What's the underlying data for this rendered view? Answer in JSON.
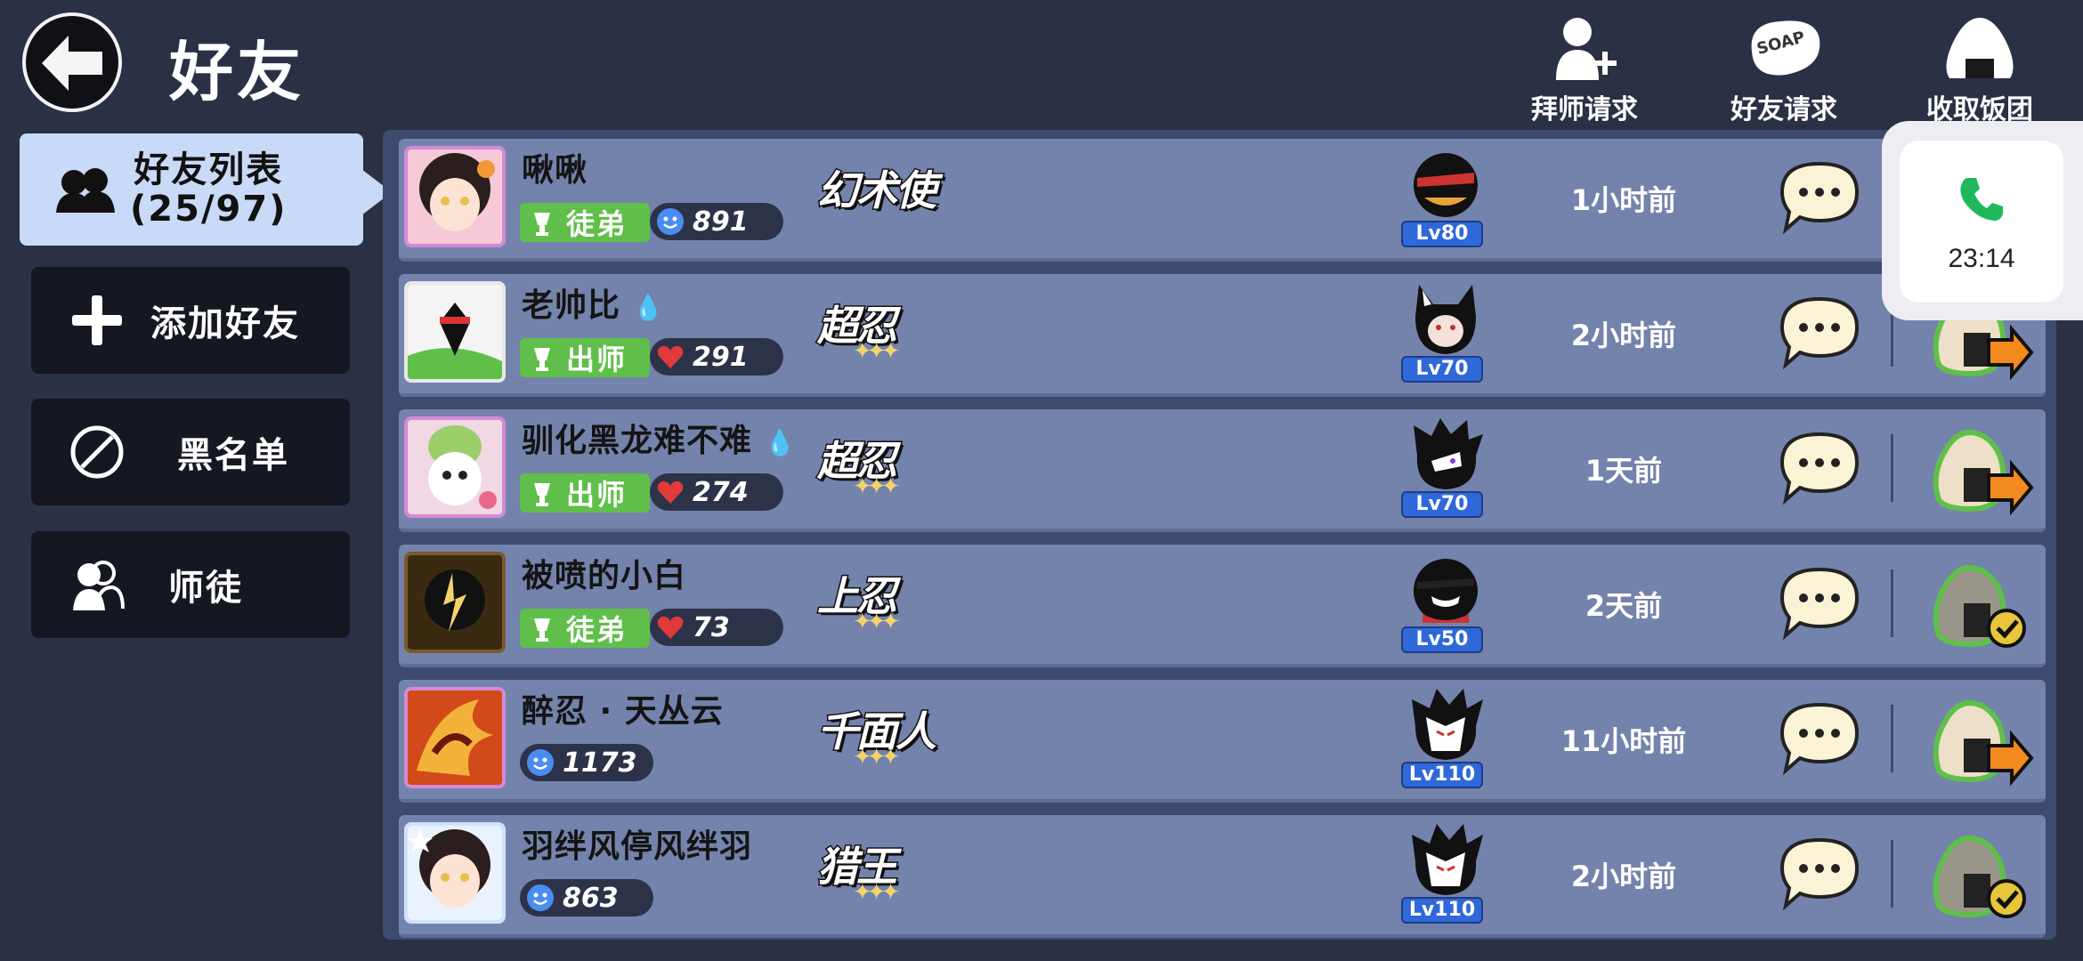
{
  "header": {
    "title": "好友",
    "actions": [
      {
        "label": "拜师请求",
        "icon": "add-mentor-icon"
      },
      {
        "label": "好友请求",
        "icon": "friend-request-icon",
        "icon_text": "SOAP"
      },
      {
        "label": "收取饭团",
        "icon": "rice-ball-icon"
      }
    ]
  },
  "sidebar": {
    "active": {
      "label": "好友列表",
      "count": "(25/97)"
    },
    "items": [
      {
        "label": "添加好友",
        "icon": "plus-icon"
      },
      {
        "label": "黑名单",
        "icon": "block-icon"
      },
      {
        "label": "师徒",
        "icon": "mentor-icon"
      }
    ]
  },
  "friends": [
    {
      "name": "啾啾",
      "relation": "徒弟",
      "stat_type": "intimacy",
      "stat": "891",
      "rank": "幻术使",
      "level": "Lv80",
      "last_seen": "1小时前",
      "gift": "send",
      "has_badge": false
    },
    {
      "name": "老帅比",
      "relation": "出师",
      "stat_type": "heart",
      "stat": "291",
      "rank": "超忍",
      "level": "Lv70",
      "last_seen": "2小时前",
      "gift": "send",
      "has_badge": true
    },
    {
      "name": "驯化黑龙难不难",
      "relation": "出师",
      "stat_type": "heart",
      "stat": "274",
      "rank": "超忍",
      "level": "Lv70",
      "last_seen": "1天前",
      "gift": "send",
      "has_badge": true
    },
    {
      "name": "被喷的小白",
      "relation": "徒弟",
      "stat_type": "heart",
      "stat": "73",
      "rank": "上忍",
      "level": "Lv50",
      "last_seen": "2天前",
      "gift": "done",
      "has_badge": false
    },
    {
      "name": "醉忍 · 天丛云",
      "relation": "",
      "stat_type": "intimacy",
      "stat": "1173",
      "rank": "千面人",
      "level": "Lv110",
      "last_seen": "11小时前",
      "gift": "send",
      "has_badge": false
    },
    {
      "name": "羽绊风停风绊羽",
      "relation": "",
      "stat_type": "intimacy",
      "stat": "863",
      "rank": "猎王",
      "level": "Lv110",
      "last_seen": "2小时前",
      "gift": "done",
      "has_badge": false
    }
  ],
  "call_overlay": {
    "time": "23:14",
    "icon": "phone-icon"
  },
  "colors": {
    "background": "#2a3145",
    "row": "#7483ac",
    "relation_badge": "#5fbf4a",
    "level_badge": "#2f68d8",
    "active_tab": "#c8daf7",
    "call_green": "#1fb85a"
  }
}
